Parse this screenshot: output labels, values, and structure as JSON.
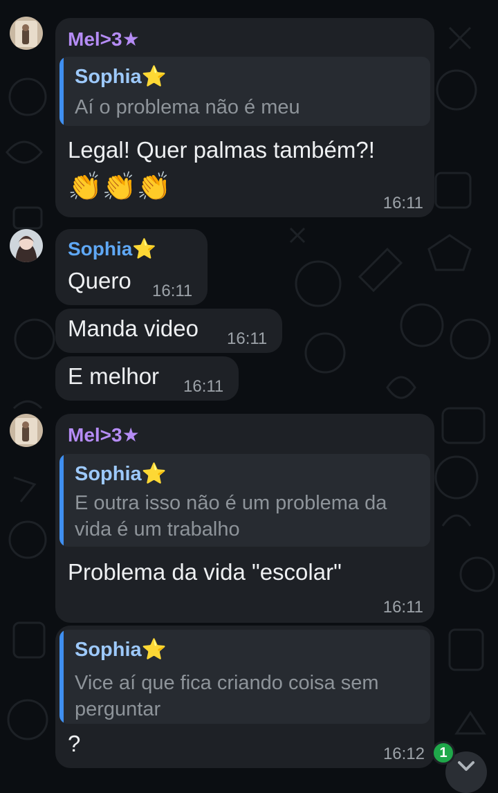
{
  "colors": {
    "background": "#0b0e12",
    "bubble": "#1e2126",
    "quote_bg": "#272b31",
    "quote_bar": "#3f8ff0",
    "mel_name": "#b58cf5",
    "sophia_name": "#5fa8f5",
    "unread_badge": "#1fa84a"
  },
  "messages": [
    {
      "sender": "Mel>3★",
      "reply_to": {
        "name": "Sophia⭐",
        "text": "Aí o problema não é meu"
      },
      "text": "Legal! Quer palmas também?!",
      "emoji": "👏👏👏",
      "time": "16:11"
    },
    {
      "sender": "Sophia⭐",
      "text": "Quero",
      "time": "16:11"
    },
    {
      "text": "Manda video",
      "time": "16:11"
    },
    {
      "text": "E melhor",
      "time": "16:11"
    },
    {
      "sender": "Mel>3★",
      "reply_to": {
        "name": "Sophia⭐",
        "text_line1": "E outra isso não é um problema da",
        "text_line2": "vida é um trabalho"
      },
      "text": "Problema da vida \"escolar\"",
      "time": "16:11"
    },
    {
      "reply_to": {
        "name": "Sophia⭐",
        "text_line1": "Vice aí que fica criando coisa sem",
        "text_line2": "perguntar"
      },
      "text": "?",
      "time": "16:12"
    }
  ],
  "unread_count": "1",
  "icons": {
    "scroll_down": "chevron-down-icon"
  }
}
